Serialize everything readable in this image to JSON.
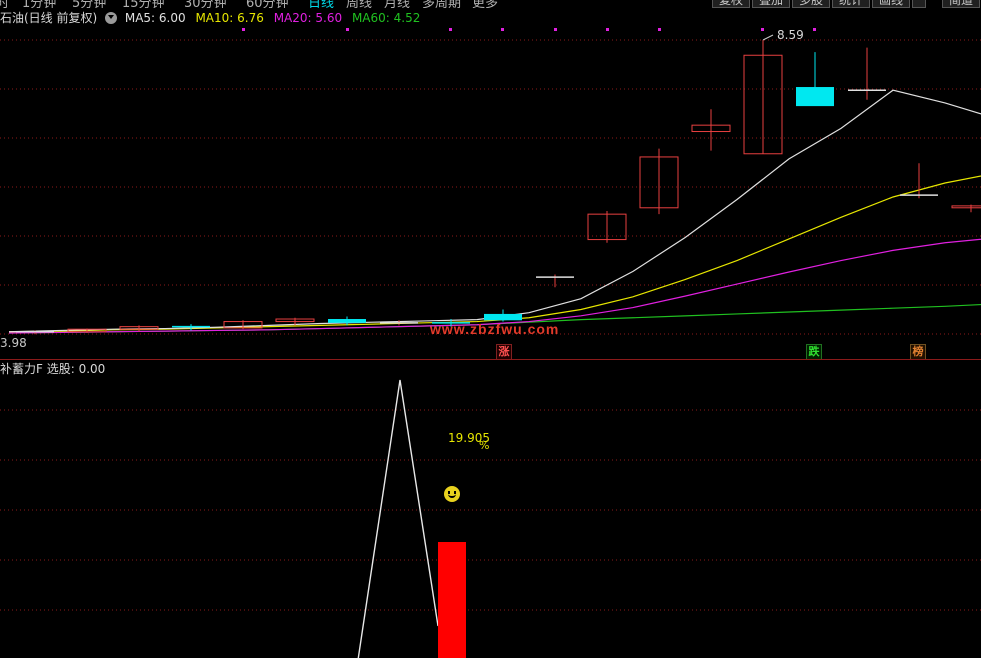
{
  "toolbar": {
    "tabs": [
      "时",
      "1分钟",
      "5分钟",
      "15分钟",
      "30分钟",
      "60分钟",
      "日线",
      "周线",
      "月线",
      "多周期",
      "更多"
    ],
    "active_tab": "日线",
    "buttons": [
      "复权",
      "叠加",
      "多股",
      "统计",
      "画线",
      "",
      "简道"
    ]
  },
  "price_header": {
    "stock_period": "石油(日线 前复权)",
    "ma5": "MA5: 6.00",
    "ma10": "MA10: 6.76",
    "ma20": "MA20: 5.60",
    "ma60": "MA60: 4.52"
  },
  "price_labels": {
    "high": "8.59",
    "low": "3.98"
  },
  "badges": {
    "zhang": "涨",
    "die": "跌",
    "bang": "榜"
  },
  "watermark": "www.zbzfwu.com",
  "indicator_header": "补蓄力F  选股: 0.00",
  "indicator_labels": {
    "value": "19.905",
    "unit": "%"
  },
  "colors": {
    "up": "#e84040",
    "down": "#00e8f0",
    "ma5": "#e0e0e0",
    "ma10": "#e6e600",
    "ma20": "#e020e0",
    "ma60": "#20c020",
    "grid": "#8b1a1a"
  },
  "chart_data": {
    "type": "candlestick",
    "ohlc": [
      {
        "o": 3.98,
        "h": 4.02,
        "l": 3.96,
        "c": 4.0
      },
      {
        "o": 4.0,
        "h": 4.05,
        "l": 3.98,
        "c": 4.04
      },
      {
        "o": 4.04,
        "h": 4.1,
        "l": 4.0,
        "c": 4.08
      },
      {
        "o": 4.08,
        "h": 4.12,
        "l": 4.02,
        "c": 4.06
      },
      {
        "o": 4.06,
        "h": 4.18,
        "l": 4.04,
        "c": 4.16
      },
      {
        "o": 4.16,
        "h": 4.22,
        "l": 4.1,
        "c": 4.2
      },
      {
        "o": 4.2,
        "h": 4.24,
        "l": 4.1,
        "c": 4.14
      },
      {
        "o": 4.14,
        "h": 4.18,
        "l": 4.1,
        "c": 4.14
      },
      {
        "o": 4.14,
        "h": 4.2,
        "l": 4.08,
        "c": 4.12
      },
      {
        "o": 4.28,
        "h": 4.35,
        "l": 4.16,
        "c": 4.18
      },
      {
        "o": 4.86,
        "h": 4.9,
        "l": 4.7,
        "c": 4.86
      },
      {
        "o": 5.45,
        "h": 5.9,
        "l": 5.4,
        "c": 5.85
      },
      {
        "o": 5.95,
        "h": 6.88,
        "l": 5.85,
        "c": 6.75
      },
      {
        "o": 7.15,
        "h": 7.5,
        "l": 6.85,
        "c": 7.25
      },
      {
        "o": 6.8,
        "h": 8.59,
        "l": 6.8,
        "c": 8.35
      },
      {
        "o": 7.85,
        "h": 8.4,
        "l": 7.75,
        "c": 7.55
      },
      {
        "o": 7.8,
        "h": 8.47,
        "l": 7.65,
        "c": 7.8
      },
      {
        "o": 6.15,
        "h": 6.65,
        "l": 6.1,
        "c": 6.15
      },
      {
        "o": 5.95,
        "h": 6.0,
        "l": 5.88,
        "c": 5.98
      },
      {
        "o": 5.9,
        "h": 6.35,
        "l": 5.9,
        "c": 6.2
      },
      {
        "o": 6.0,
        "h": 6.05,
        "l": 5.9,
        "c": 5.98
      }
    ],
    "ma5": [
      4.0,
      4.02,
      4.04,
      4.05,
      4.07,
      4.1,
      4.13,
      4.15,
      4.17,
      4.19,
      4.3,
      4.52,
      4.95,
      5.48,
      6.08,
      6.72,
      7.2,
      7.8,
      7.6,
      7.35,
      7.08,
      6.9
    ],
    "ma10": [
      4.0,
      4.01,
      4.03,
      4.04,
      4.06,
      4.08,
      4.1,
      4.12,
      4.14,
      4.16,
      4.22,
      4.35,
      4.55,
      4.82,
      5.12,
      5.46,
      5.8,
      6.12,
      6.34,
      6.5,
      6.62,
      6.76
    ],
    "ma20": [
      3.98,
      3.99,
      4.0,
      4.01,
      4.02,
      4.03,
      4.05,
      4.07,
      4.09,
      4.11,
      4.16,
      4.25,
      4.38,
      4.56,
      4.75,
      4.94,
      5.12,
      5.28,
      5.4,
      5.48,
      5.55,
      5.6
    ],
    "ma60": [
      3.98,
      3.99,
      4.0,
      4.01,
      4.02,
      4.03,
      4.05,
      4.07,
      4.09,
      4.11,
      4.15,
      4.19,
      4.22,
      4.25,
      4.28,
      4.31,
      4.34,
      4.37,
      4.4,
      4.44,
      4.48,
      4.52
    ],
    "indicator": {
      "line": [
        0,
        100,
        18
      ],
      "bar": 19.905
    }
  }
}
